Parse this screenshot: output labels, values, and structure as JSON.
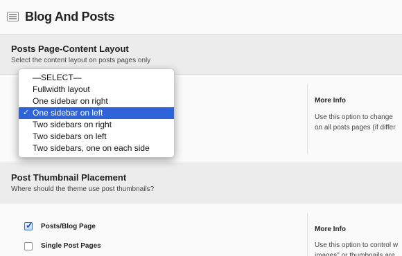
{
  "header": {
    "title": "Blog And Posts",
    "icon": "document-icon"
  },
  "section1": {
    "title": "Posts Page-Content Layout",
    "description": "Select the content layout on posts pages only",
    "more_info_title": "More Info",
    "more_info_lines": [
      "Use this option to change",
      "on all posts pages (if differ"
    ]
  },
  "dropdown": {
    "selected_index": 3,
    "options": [
      "—SELECT—",
      "Fullwidth layout",
      "One sidebar on right",
      "One sidebar on left",
      "Two sidebars on right",
      "Two sidebars on left",
      "Two sidebars, one on each side"
    ],
    "selected_color": "#2f63d9"
  },
  "section2": {
    "title": "Post Thumbnail Placement",
    "description": "Where should the theme use post thumbnails?",
    "more_info_title": "More Info",
    "more_info_lines": [
      "Use this option to control w",
      "images\" or thumbnails are"
    ],
    "checkboxes": [
      {
        "label": "Posts/Blog Page",
        "checked": true
      },
      {
        "label": "Single Post Pages",
        "checked": false
      }
    ]
  }
}
